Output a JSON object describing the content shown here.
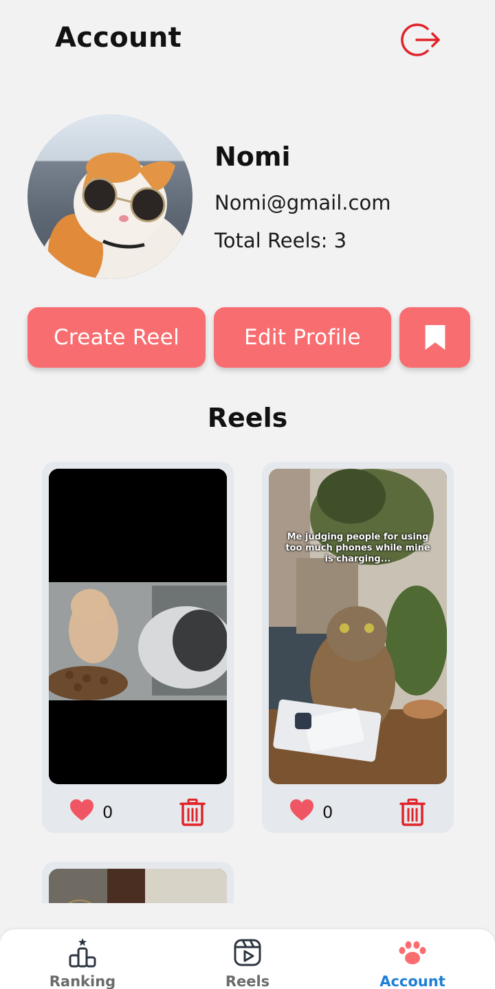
{
  "header": {
    "title": "Account",
    "logout_icon": "logout-icon"
  },
  "profile": {
    "name": "Nomi",
    "email": "Nomi@gmail.com",
    "total_reels": "Total Reels: 3"
  },
  "actions": {
    "create_label": "Create Reel",
    "edit_label": "Edit Profile",
    "bookmark_icon": "bookmark-icon"
  },
  "reels_section": {
    "heading": "Reels",
    "items": [
      {
        "likes": "0",
        "caption": ""
      },
      {
        "likes": "0",
        "caption": "Me judging people for using too much phones while mine is charging..."
      },
      {
        "likes": "",
        "caption": ""
      }
    ]
  },
  "nav": {
    "items": [
      {
        "label": "Ranking",
        "icon": "ranking-icon",
        "active": false
      },
      {
        "label": "Reels",
        "icon": "reels-icon",
        "active": false
      },
      {
        "label": "Account",
        "icon": "paw-icon",
        "active": true
      }
    ]
  },
  "colors": {
    "accent": "#f86d70",
    "danger": "#e0242a",
    "active_nav": "#1e7fd6",
    "background": "#f2f2f3"
  }
}
